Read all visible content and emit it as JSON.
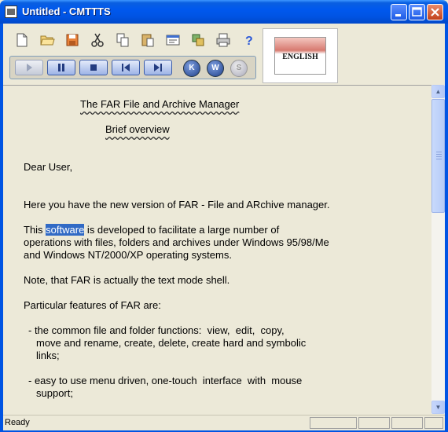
{
  "window": {
    "title": "Untitled - CMTTTS",
    "controls": [
      "minimize",
      "maximize",
      "close"
    ]
  },
  "toolbar": {
    "buttons": [
      {
        "name": "new-icon"
      },
      {
        "name": "open-folder-icon"
      },
      {
        "name": "save-disk-icon"
      },
      {
        "name": "cut-scissors-icon"
      },
      {
        "name": "copy-icon"
      },
      {
        "name": "paste-icon"
      },
      {
        "name": "properties-icon"
      },
      {
        "name": "settings-icon"
      },
      {
        "name": "print-icon"
      },
      {
        "name": "help-icon"
      }
    ]
  },
  "player": {
    "buttons": [
      {
        "name": "play-button",
        "state": "disabled"
      },
      {
        "name": "pause-button"
      },
      {
        "name": "stop-button"
      },
      {
        "name": "previous-button"
      },
      {
        "name": "next-button"
      }
    ],
    "circle_buttons": [
      {
        "name": "k-button",
        "label": "K"
      },
      {
        "name": "w-button",
        "label": "W"
      },
      {
        "name": "s-button",
        "label": "S",
        "state": "disabled"
      }
    ]
  },
  "language": {
    "label": "ENGLISH"
  },
  "document": {
    "title": "The FAR File and Archive Manager",
    "subtitle": "Brief overview",
    "greeting": "Dear User,",
    "p1": "Here you have the new version of FAR - File and ARchive manager.",
    "p2_before": "This ",
    "p2_highlight": "software",
    "p2_after": " is developed to facilitate a large number of",
    "p2_l2": "operations with files, folders and archives under Windows 95/98/Me",
    "p2_l3": "and Windows NT/2000/XP operating systems.",
    "p3": "Note, that FAR is actually the text mode shell.",
    "p4": "Particular features of FAR are:",
    "b1_l1": "- the common file and folder functions:  view,  edit,  copy,",
    "b1_l2": "move and rename, create, delete, create hard and symbolic",
    "b1_l3": "links;",
    "b2_l1": "- easy to use menu driven, one-touch  interface  with  mouse",
    "b2_l2": "support;"
  },
  "status": {
    "text": "Ready"
  },
  "colors": {
    "titlebar": "#0054e3",
    "selection": "#316ac5",
    "background": "#ece9d8"
  }
}
